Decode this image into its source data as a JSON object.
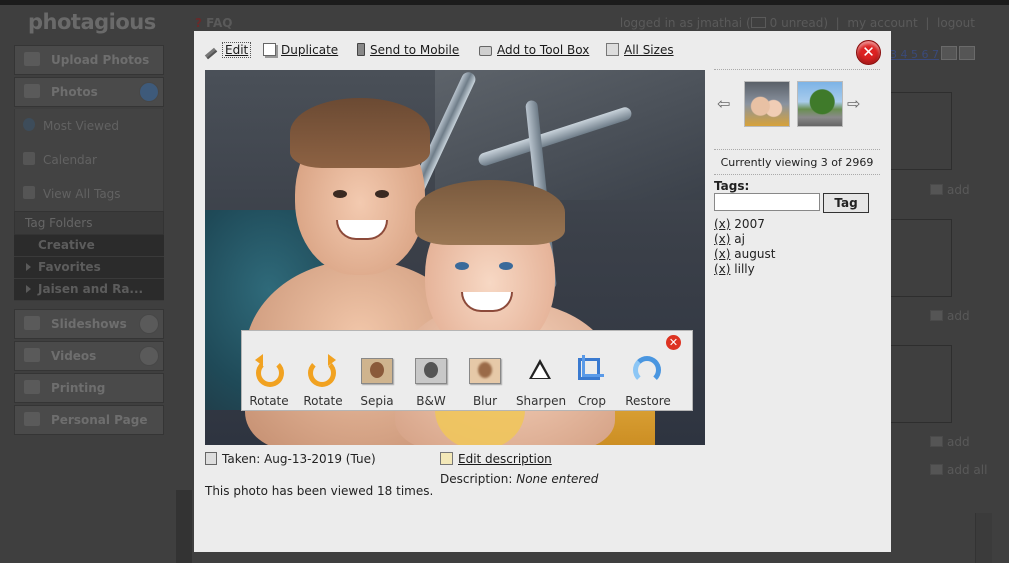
{
  "background": {
    "logo": "photagious",
    "faq_label": "FAQ",
    "faq_mark": "?",
    "userbar": {
      "logged_in": "logged in as jmathai",
      "unread": "0 unread",
      "my_account": "my account",
      "logout": "logout"
    },
    "sidebar": {
      "upload": "Upload Photos",
      "photos": "Photos",
      "most_viewed": "Most Viewed",
      "calendar": "Calendar",
      "view_all_tags": "View All Tags",
      "tag_folders": "Tag Folders",
      "folders": [
        "Creative",
        "Favorites",
        "Jaisen and Ra..."
      ],
      "slideshows": "Slideshows",
      "videos": "Videos",
      "printing": "Printing",
      "personal_page": "Personal Page"
    },
    "pager": "3 4 5 6 7",
    "add_labels": [
      "add",
      "add",
      "add"
    ],
    "add_all": "add all"
  },
  "modal": {
    "toolbar": {
      "edit": "Edit",
      "duplicate": "Duplicate",
      "send_to_mobile": "Send to Mobile",
      "add_to_toolbox": "Add to Tool Box",
      "all_sizes": "All Sizes"
    },
    "tools": [
      "Rotate",
      "Rotate",
      "Sepia",
      "B&W",
      "Blur",
      "Sharpen",
      "Crop",
      "Restore"
    ],
    "currently_viewing": "Currently viewing 3 of 2969",
    "tags_label": "Tags:",
    "tag_input_placeholder": "",
    "tag_button": "Tag",
    "tags": [
      "2007",
      "aj",
      "august",
      "lilly"
    ],
    "tag_remove": "(x)",
    "taken": "Taken: Aug-13-2019 (Tue)",
    "edit_description": "Edit description",
    "description_label": "Description:",
    "description_value": "None entered",
    "viewed": "This photo has been viewed 18 times."
  }
}
